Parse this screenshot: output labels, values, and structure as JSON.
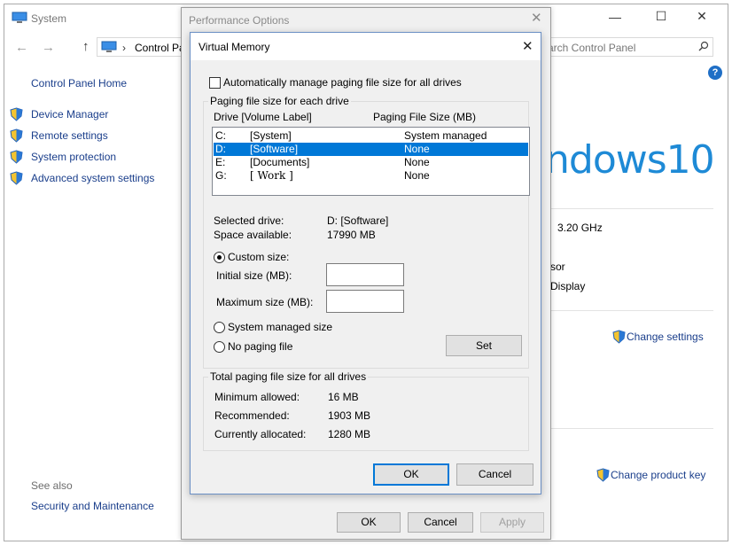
{
  "system_window": {
    "title": "System",
    "address": "Control Pa",
    "search_placeholder": "arch Control Panel",
    "sidebar": {
      "home": "Control Panel Home",
      "links": [
        "Device Manager",
        "Remote settings",
        "System protection",
        "Advanced system settings"
      ],
      "see_also_heading": "See also",
      "see_also_link": "Security and Maintenance"
    },
    "brand": "ndows10",
    "cpu_speed": "3.20 GHz",
    "processor_fragment": "sor",
    "display_fragment": "Display",
    "change_settings": "Change settings",
    "change_product_key": "Change product key",
    "help_glyph": "?"
  },
  "performance_options": {
    "title": "Performance Options",
    "ok": "OK",
    "cancel": "Cancel",
    "apply": "Apply"
  },
  "virtual_memory": {
    "title": "Virtual Memory",
    "auto_manage_label": "Automatically manage paging file size for all drives",
    "auto_manage_checked": false,
    "paging_group_title": "Paging file size for each drive",
    "col_drive": "Drive  [Volume Label]",
    "col_size": "Paging File Size (MB)",
    "drives": [
      {
        "drive": "C:",
        "label": "[System]",
        "size": "System managed",
        "selected": false
      },
      {
        "drive": "D:",
        "label": "[Software]",
        "size": "None",
        "selected": true
      },
      {
        "drive": "E:",
        "label": "[Documents]",
        "size": "None",
        "selected": false
      },
      {
        "drive": "G:",
        "label": "[ Work  ]",
        "size": "None",
        "selected": false
      }
    ],
    "selected_drive_label": "Selected drive:",
    "selected_drive_value": "D:  [Software]",
    "space_available_label": "Space available:",
    "space_available_value": "17990 MB",
    "custom_size_label": "Custom size:",
    "initial_size_label": "Initial size (MB):",
    "initial_size_value": "",
    "maximum_size_label": "Maximum size (MB):",
    "maximum_size_value": "",
    "system_managed_label": "System managed size",
    "no_paging_label": "No paging file",
    "set_button": "Set",
    "totals_group_title": "Total paging file size for all drives",
    "minimum_allowed_label": "Minimum allowed:",
    "minimum_allowed_value": "16 MB",
    "recommended_label": "Recommended:",
    "recommended_value": "1903 MB",
    "currently_allocated_label": "Currently allocated:",
    "currently_allocated_value": "1280 MB",
    "ok": "OK",
    "cancel": "Cancel"
  },
  "colors": {
    "accent": "#0078d7",
    "link": "#1a3e8b",
    "windows_blue": "#1e8ad6"
  }
}
